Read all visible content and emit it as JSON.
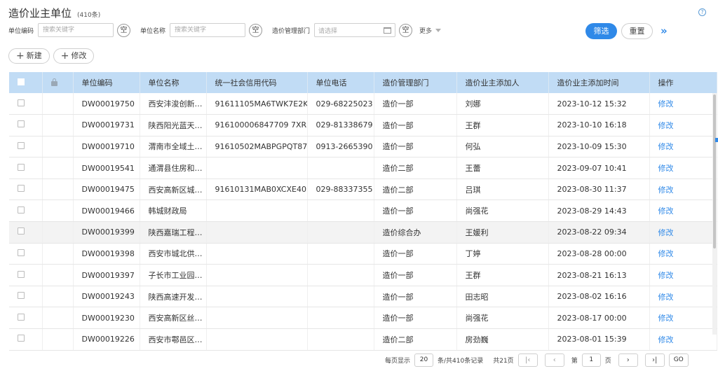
{
  "header": {
    "title": "造价业主单位",
    "count": "(410条)",
    "help_icon": "question-circle-icon"
  },
  "filters": {
    "code_label": "单位编码",
    "code_placeholder": "搜索关键字",
    "name_label": "单位名称",
    "name_placeholder": "搜索关键字",
    "dept_label": "造价管理部门",
    "dept_placeholder": "请选择",
    "clear_label": "空",
    "more_label": "更多"
  },
  "buttons": {
    "filter": "筛选",
    "reset": "重置",
    "expand": "»",
    "add": "新建",
    "edit": "修改"
  },
  "table": {
    "columns": [
      "单位编码",
      "单位名称",
      "统一社会信用代码",
      "单位电话",
      "造价管理部门",
      "造价业主添加人",
      "造价业主添加时间",
      "操作"
    ],
    "rows": [
      [
        "DW00019750",
        "西安沣浚创新…",
        "91611105MA6TWK7E2K",
        "029-68225023",
        "造价一部",
        "刘娜",
        "2023-10-12 15:32",
        "修改"
      ],
      [
        "DW00019731",
        "陕西阳光蓝天…",
        "916100006847709 7XR",
        "029-81338679",
        "造价一部",
        "王群",
        "2023-10-10 16:18",
        "修改"
      ],
      [
        "DW00019710",
        "渭南市全域土…",
        "91610502MABPGPQT87",
        "0913-2665390",
        "造价一部",
        "何弘",
        "2023-10-09 15:30",
        "修改"
      ],
      [
        "DW00019541",
        "通渭县住房和…",
        "",
        "",
        "造价二部",
        "王蕾",
        "2023-09-07 10:41",
        "修改"
      ],
      [
        "DW00019475",
        "西安高新区城…",
        "91610131MAB0XCXE40",
        "029-88337355",
        "造价二部",
        "吕琪",
        "2023-08-30 11:37",
        "修改"
      ],
      [
        "DW00019466",
        "韩城财政局",
        "",
        "",
        "造价一部",
        "尚强花",
        "2023-08-29 14:43",
        "修改"
      ],
      [
        "DW00019399",
        "陕西嘉瑞工程…",
        "",
        "",
        "造价综合办",
        "王媛利",
        "2023-08-22 09:34",
        "修改"
      ],
      [
        "DW00019398",
        "西安市城北供…",
        "",
        "",
        "造价一部",
        "丁婷",
        "2023-08-28 00:00",
        "修改"
      ],
      [
        "DW00019397",
        "子长市工业园…",
        "",
        "",
        "造价一部",
        "王群",
        "2023-08-21 16:13",
        "修改"
      ],
      [
        "DW00019243",
        "陕西高速开发…",
        "",
        "",
        "造价一部",
        "田志昭",
        "2023-08-02 16:16",
        "修改"
      ],
      [
        "DW00019230",
        "西安高新区丝…",
        "",
        "",
        "造价一部",
        "尚强花",
        "2023-08-17 00:00",
        "修改"
      ],
      [
        "DW00019226",
        "西安市鄠邑区…",
        "",
        "",
        "造价二部",
        "房劲巍",
        "2023-08-01 15:39",
        "修改"
      ]
    ]
  },
  "pagination": {
    "per_page_label": "每页显示",
    "per_page": "20",
    "total_label": "条/共410条记录",
    "pages_label": "共21页",
    "page_prefix": "第",
    "current_page": "1",
    "page_suffix": "页",
    "go": "GO"
  }
}
